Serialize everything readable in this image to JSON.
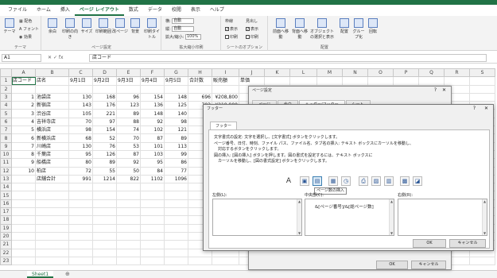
{
  "ribbon_tabs": [
    "ファイル",
    "ホーム",
    "挿入",
    "ページ レイアウト",
    "数式",
    "データ",
    "校閲",
    "表示",
    "ヘルプ"
  ],
  "ribbon_active": "ページ レイアウト",
  "ribbon": {
    "theme": {
      "theme_btn": "テーマ",
      "colors": "配色",
      "fonts": "フォント",
      "effects": "効果",
      "group": "テーマ"
    },
    "pagesetup": {
      "margins": "余白",
      "orientation": "印刷の向き",
      "size": "サイズ",
      "print_area": "印刷範囲",
      "breaks": "改ページ",
      "background": "背景",
      "print_titles": "印刷タイトル",
      "group": "ページ設定"
    },
    "scale": {
      "width_label": "横:",
      "width_value": "自動",
      "height_label": "縦:",
      "height_value": "自動",
      "scale_label": "拡大/縮小:",
      "scale_value": "100%",
      "group": "拡大縮小印刷"
    },
    "sheetopts": {
      "grid": "枠線",
      "headings": "見出し",
      "view": "表示",
      "print": "印刷",
      "group": "シートのオプション"
    },
    "arrange": {
      "forward": "前面へ移動",
      "backward": "背面へ移動",
      "selection": "オブジェクトの選択と表示",
      "align": "配置",
      "group_btn": "グループ化",
      "rotate": "回転",
      "group": "配置"
    }
  },
  "namebox": "A1",
  "fx": "fx",
  "formula": "店コード",
  "columns": [
    "A",
    "B",
    "C",
    "D",
    "E",
    "F",
    "G",
    "H",
    "I",
    "J",
    "K",
    "L",
    "M",
    "N",
    "O",
    "P",
    "Q",
    "R",
    "S"
  ],
  "rows": [
    [
      "1",
      "店コード",
      "店名",
      "9月1日",
      "9月2日",
      "9月3日",
      "9月4日",
      "9月5日",
      "合計数",
      "販売額",
      "単価"
    ],
    [
      "2",
      "",
      "",
      "",
      "",
      "",
      "",
      "",
      "",
      "",
      ""
    ],
    [
      "3",
      "1",
      "池袋店",
      "130",
      "168",
      "96",
      "154",
      "148",
      "696",
      "¥208,800",
      ""
    ],
    [
      "4",
      "2",
      "新宿店",
      "143",
      "176",
      "123",
      "136",
      "125",
      "703",
      "¥210,900",
      ""
    ],
    [
      "5",
      "3",
      "渋谷店",
      "105",
      "221",
      "89",
      "148",
      "140",
      "",
      "",
      ""
    ],
    [
      "6",
      "4",
      "吉祥寺店",
      "70",
      "97",
      "88",
      "92",
      "98",
      "",
      "",
      ""
    ],
    [
      "7",
      "5",
      "横浜店",
      "98",
      "154",
      "74",
      "102",
      "121",
      "",
      "",
      ""
    ],
    [
      "8",
      "6",
      "新横浜店",
      "68",
      "52",
      "70",
      "87",
      "89",
      "",
      "",
      ""
    ],
    [
      "9",
      "7",
      "川崎店",
      "130",
      "76",
      "53",
      "101",
      "113",
      "",
      "",
      ""
    ],
    [
      "10",
      "8",
      "千葉店",
      "95",
      "126",
      "87",
      "103",
      "99",
      "",
      "",
      ""
    ],
    [
      "11",
      "9",
      "船橋店",
      "80",
      "89",
      "92",
      "95",
      "86",
      "",
      "",
      ""
    ],
    [
      "12",
      "10",
      "柏店",
      "72",
      "55",
      "50",
      "84",
      "77",
      "",
      "",
      ""
    ],
    [
      "13",
      "",
      "店舗合計",
      "991",
      "1214",
      "822",
      "1102",
      "1096",
      "",
      "",
      ""
    ],
    [
      "14",
      "",
      "",
      "",
      "",
      "",
      "",
      "",
      "",
      "",
      ""
    ],
    [
      "15",
      "",
      "",
      "",
      "",
      "",
      "",
      "",
      "",
      "",
      ""
    ],
    [
      "16",
      "",
      "",
      "",
      "",
      "",
      "",
      "",
      "",
      "",
      ""
    ],
    [
      "17",
      "",
      "",
      "",
      "",
      "",
      "",
      "",
      "",
      "",
      ""
    ],
    [
      "18",
      "",
      "",
      "",
      "",
      "",
      "",
      "",
      "",
      "",
      ""
    ],
    [
      "19",
      "",
      "",
      "",
      "",
      "",
      "",
      "",
      "",
      "",
      ""
    ],
    [
      "20",
      "",
      "",
      "",
      "",
      "",
      "",
      "",
      "",
      "",
      ""
    ],
    [
      "21",
      "",
      "",
      "",
      "",
      "",
      "",
      "",
      "",
      "",
      ""
    ],
    [
      "22",
      "",
      "",
      "",
      "",
      "",
      "",
      "",
      "",
      "",
      ""
    ],
    [
      "23",
      "",
      "",
      "",
      "",
      "",
      "",
      "",
      "",
      "",
      ""
    ]
  ],
  "sheet_tab": "Sheet1",
  "pagesetup": {
    "title": "ページ設定",
    "tabs": [
      "ページ",
      "余白",
      "ヘッダー/フッター",
      "シート"
    ],
    "ok": "OK",
    "cancel": "キャンセル"
  },
  "footer": {
    "title": "フッター",
    "tab": "フッター",
    "instructions": [
      "文字書式の設定: 文字を選択し、[文字書式] ボタンをクリックします。",
      "ページ番号、日付、時刻、ファイル パス、ファイル名、タブ名の挿入: テキスト ボックスにカーソルを移動し、",
      "　対応するボタンをクリックします。",
      "図の挿入: [図の挿入] ボタンを押します。図の書式を設定するには、テキスト ボックスに",
      "　カーソルを移動し、[図の書式設定] ボタンをクリックします。"
    ],
    "tooltip": "ページ数の挿入",
    "left_label": "左側(L):",
    "center_label": "中央部(C):",
    "right_label": "右側(R):",
    "center_text": "&[ページ番号]/&[総ページ数]",
    "ok": "OK",
    "cancel": "キャンセル",
    "help": "?",
    "close": "✕"
  }
}
